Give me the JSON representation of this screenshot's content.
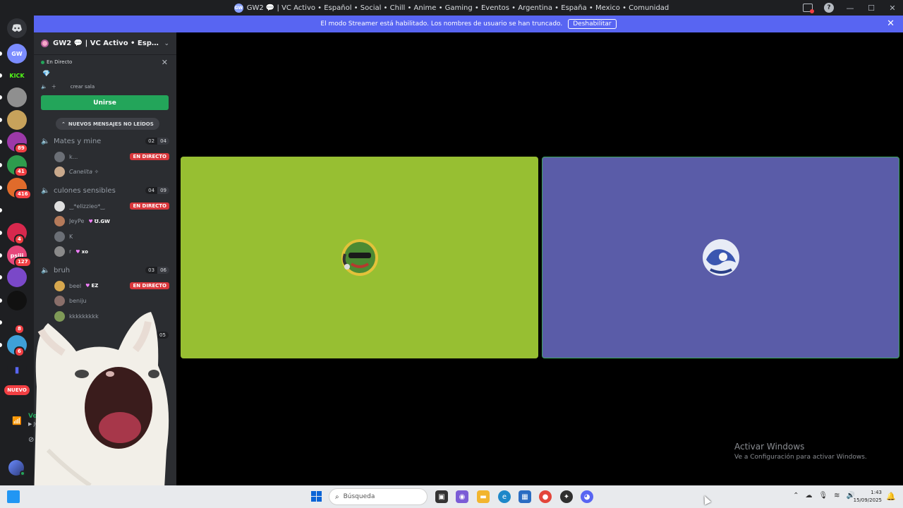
{
  "titlebar": {
    "title": "GW2 💬 | VC Activo • Español • Social • Chill • Anime • Gaming • Eventos • Argentina • España • Mexico • Comunidad",
    "badge": "GW",
    "help": "?"
  },
  "banner": {
    "message": "El modo Streamer está habilitado. Los nombres de usuario se han truncado.",
    "disable_label": "Deshabilitar"
  },
  "rail": {
    "servers": [
      {
        "label": "GW",
        "color": "#7b8cff",
        "badge": ""
      },
      {
        "label": "KICK",
        "color": "#1e1f22",
        "badge": ""
      },
      {
        "label": "",
        "color": "#8f8f8f",
        "badge": ""
      },
      {
        "label": "",
        "color": "#c7a25b",
        "badge": ""
      },
      {
        "label": "",
        "color": "#9c39a8",
        "badge": "89"
      },
      {
        "label": "",
        "color": "#2e9c4d",
        "badge": "41"
      },
      {
        "label": "",
        "color": "#e06b2b",
        "badge": "416"
      },
      {
        "label": "",
        "color": "#1e1f22",
        "badge": ""
      },
      {
        "label": "",
        "color": "#d8284d",
        "badge": "4"
      },
      {
        "label": "psiii",
        "color": "#e7477b",
        "badge": "127"
      },
      {
        "label": "",
        "color": "#7a48c8",
        "badge": ""
      },
      {
        "label": "",
        "color": "#111111",
        "badge": ""
      },
      {
        "label": "",
        "color": "#1e1f22",
        "badge": "8"
      },
      {
        "label": "",
        "color": "#3fa0d8",
        "badge": "6"
      }
    ],
    "new_label": "NUEVO"
  },
  "guild": {
    "name": "GW2 💬 | VC Activo • Español...",
    "live_label": "En Directo",
    "create_room": "crear sala",
    "join_label": "Unirse",
    "unread_label": "NUEVOS MENSAJES NO LEÍDOS"
  },
  "channels": [
    {
      "name": "Mates y mine",
      "count_a": "02",
      "count_b": "04",
      "members": [
        {
          "name": "k...",
          "tag": "",
          "live": "EN DIRECTO",
          "italic": false,
          "color": "#6b6f76"
        },
        {
          "name": "Canelita ✧",
          "tag": "",
          "live": "",
          "italic": true,
          "color": "#c9a98c"
        }
      ]
    },
    {
      "name": "culones sensibles",
      "count_a": "04",
      "count_b": "09",
      "members": [
        {
          "name": "‿*elizzieo*‿",
          "tag": "",
          "live": "EN DIRECTO",
          "italic": false,
          "color": "#dfdfdf"
        },
        {
          "name": "JeyPe",
          "tag": "Ʊ.GW",
          "live": "",
          "italic": false,
          "color": "#b57a5a"
        },
        {
          "name": "K",
          "tag": "",
          "live": "",
          "italic": false,
          "color": "#6b6f76"
        },
        {
          "name": "r",
          "tag": "xo",
          "live": "",
          "italic": false,
          "color": "#8a8a8a"
        }
      ]
    },
    {
      "name": "bruh",
      "count_a": "03",
      "count_b": "06",
      "members": [
        {
          "name": "beel",
          "tag": "EZ",
          "live": "EN DIRECTO",
          "italic": false,
          "color": "#d6a74e"
        },
        {
          "name": "beniju",
          "tag": "",
          "live": "",
          "italic": false,
          "color": "#8a6f6a"
        },
        {
          "name": "kkkkkkkkk",
          "tag": "",
          "live": "",
          "italic": false,
          "color": "#7f9a57"
        }
      ]
    }
  ],
  "hidden_count": "05",
  "voice": {
    "status": "Voz cone",
    "sub": "▶ Jugand"
  },
  "stage": {
    "tiles": [
      {
        "color": "#97bf32"
      },
      {
        "color": "#5a5ca8"
      }
    ]
  },
  "activate": {
    "heading": "Activar Windows",
    "sub": "Ve a Configuración para activar Windows."
  },
  "taskbar": {
    "search_placeholder": "Búsqueda",
    "time": "1:43",
    "date": "15/09/2025"
  }
}
